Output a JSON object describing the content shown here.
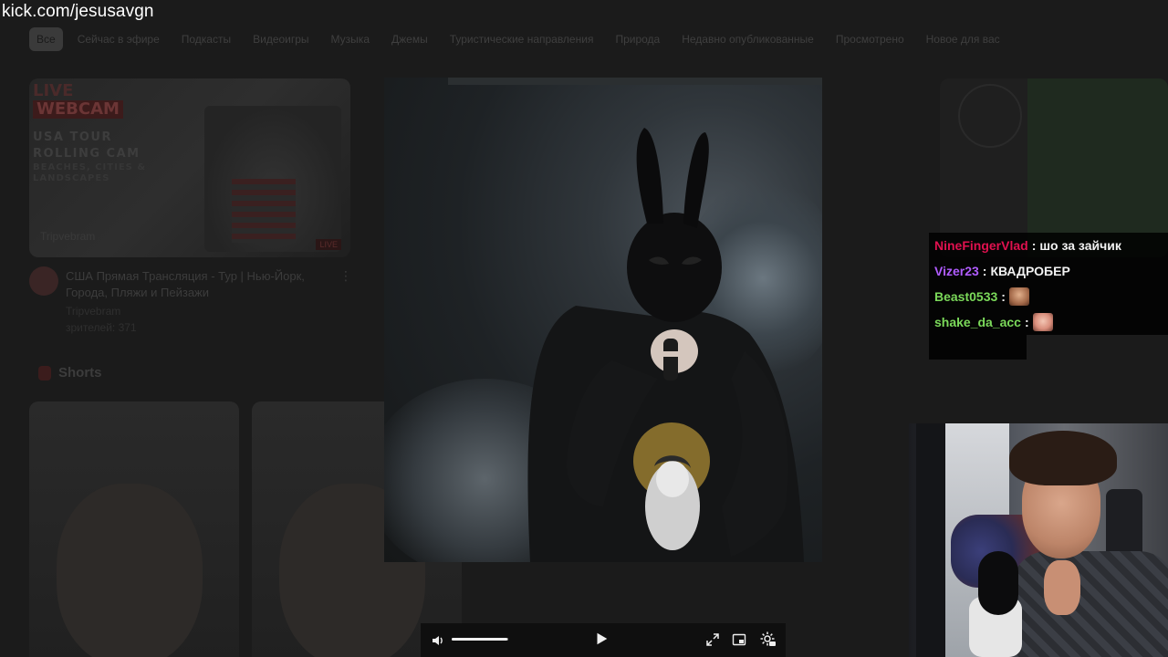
{
  "watermark": {
    "url": "kick.com/jesusavgn"
  },
  "background_page": {
    "chips": [
      "Все",
      "Сейчас в эфире",
      "Подкасты",
      "Видеоигры",
      "Музыка",
      "Джемы",
      "Туристические направления",
      "Природа",
      "Недавно опубликованные",
      "Просмотрено",
      "Новое для вас"
    ],
    "active_chip": "Все",
    "featured_video": {
      "thumb_live": "LIVE",
      "thumb_webcam": "WEBCAM",
      "thumb_line1": "USA TOUR",
      "thumb_line2": "ROLLING CAM",
      "thumb_sub1": "BEACHES, CITIES &",
      "thumb_sub2": "LANDSCAPES",
      "thumb_brand": "Tripvebram",
      "title": "США Прямая Трансляция - Тур | Нью-Йорк, Города, Пляжи и Пейзажи",
      "channel": "Tripvebram",
      "viewers": "зрителей: 371"
    },
    "shorts_label": "Shorts"
  },
  "chat": {
    "messages": [
      {
        "user": "NineFingerVlad",
        "color": "#e0114f",
        "text": "шо за зайчик",
        "emote": ""
      },
      {
        "user": "Vizer23",
        "color": "#b05cff",
        "text": "КВАДРОБЕР",
        "emote": ""
      },
      {
        "user": "Beast0533",
        "color": "#7bd95a",
        "text": "",
        "emote": "laughing-face-emote"
      },
      {
        "user": "shake_da_acc",
        "color": "#7bd95a",
        "text": "",
        "emote": "face-emote"
      }
    ],
    "separator": ":"
  },
  "player": {
    "volume_level": 0.99,
    "icons": {
      "volume": "speaker-icon",
      "play": "play-icon",
      "fullscreen": "fullscreen-icon",
      "pip": "picture-in-picture-icon",
      "settings": "settings-gear-icon"
    }
  }
}
